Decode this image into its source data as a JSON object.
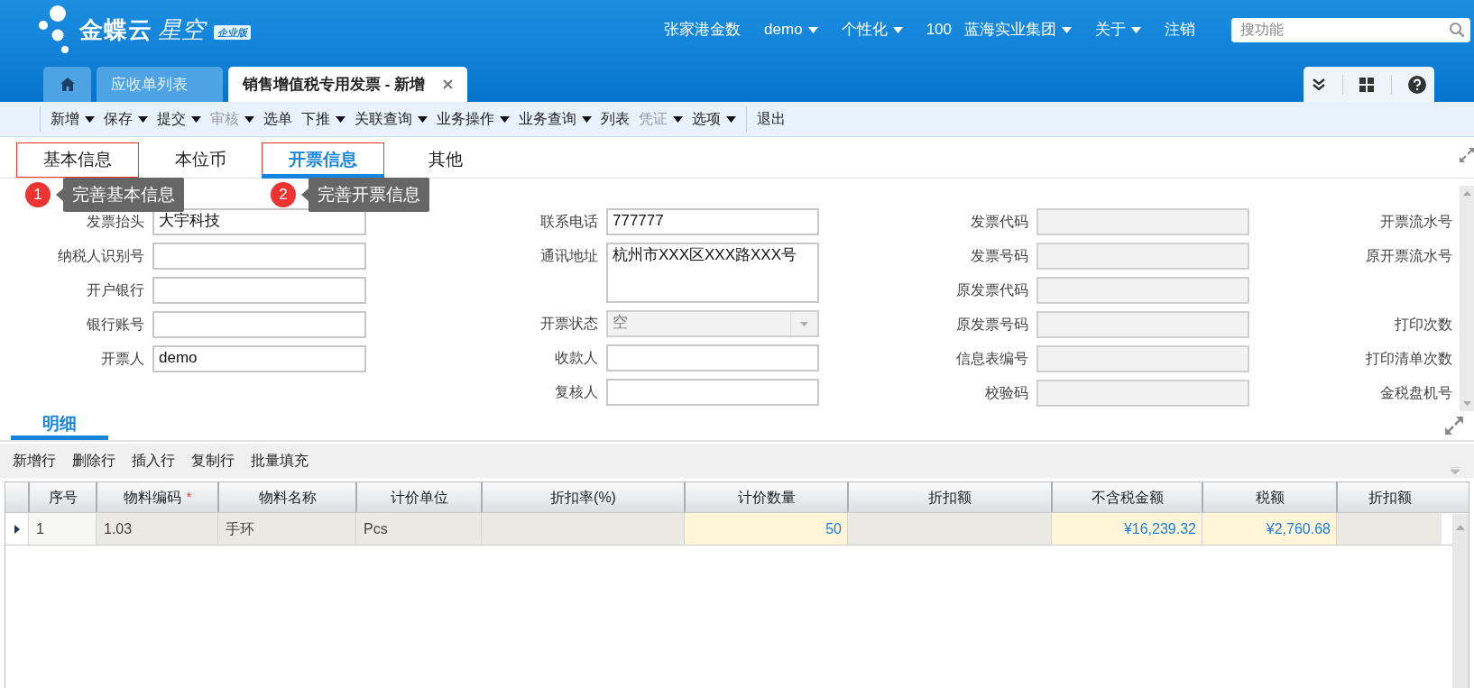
{
  "header": {
    "logo": {
      "brand": "金蝶云",
      "product": "星空",
      "edition": "企业版"
    },
    "nav": [
      {
        "label": "张家港金数",
        "dropdown": false
      },
      {
        "label": "demo",
        "dropdown": true
      },
      {
        "label": "个性化",
        "dropdown": true
      },
      {
        "code": "100",
        "label": "蓝海实业集团",
        "dropdown": true
      },
      {
        "label": "关于",
        "dropdown": true
      },
      {
        "label": "注销",
        "dropdown": false
      }
    ],
    "search": {
      "placeholder": "搜功能"
    }
  },
  "tabs": [
    {
      "kind": "home",
      "selected": false
    },
    {
      "kind": "page",
      "label": "应收单列表",
      "selected": false,
      "closable": false
    },
    {
      "kind": "page",
      "label": "销售增值税专用发票 - 新增",
      "selected": true,
      "closable": true
    }
  ],
  "toolbar": [
    {
      "kind": "divider"
    },
    {
      "kind": "button",
      "label": "新增",
      "dropdown": true,
      "disabled": false
    },
    {
      "kind": "button",
      "label": "保存",
      "dropdown": true,
      "disabled": false
    },
    {
      "kind": "button",
      "label": "提交",
      "dropdown": true,
      "disabled": false
    },
    {
      "kind": "button",
      "label": "审核",
      "dropdown": true,
      "disabled": true
    },
    {
      "kind": "button",
      "label": "选单",
      "dropdown": false,
      "disabled": false
    },
    {
      "kind": "button",
      "label": "下推",
      "dropdown": true,
      "disabled": false
    },
    {
      "kind": "button",
      "label": "关联查询",
      "dropdown": true,
      "disabled": false
    },
    {
      "kind": "button",
      "label": "业务操作",
      "dropdown": true,
      "disabled": false
    },
    {
      "kind": "button",
      "label": "业务查询",
      "dropdown": true,
      "disabled": false
    },
    {
      "kind": "button",
      "label": "列表",
      "dropdown": false,
      "disabled": false
    },
    {
      "kind": "button",
      "label": "凭证",
      "dropdown": true,
      "disabled": true
    },
    {
      "kind": "button",
      "label": "选项",
      "dropdown": true,
      "disabled": false
    },
    {
      "kind": "divider"
    },
    {
      "kind": "button",
      "label": "退出",
      "dropdown": false,
      "disabled": false
    }
  ],
  "form_tabs": [
    {
      "label": "基本信息",
      "selected": false,
      "highlighted": true,
      "callout": {
        "number": "1",
        "text": "完善基本信息"
      }
    },
    {
      "label": "本位币",
      "selected": false,
      "highlighted": false
    },
    {
      "label": "开票信息",
      "selected": true,
      "highlighted": true,
      "callout": {
        "number": "2",
        "text": "完善开票信息"
      }
    },
    {
      "label": "其他",
      "selected": false,
      "highlighted": false
    }
  ],
  "form": {
    "columns": [
      [
        {
          "kind": "text",
          "label": "发票抬头",
          "value": "大宇科技",
          "disabled": false
        },
        {
          "kind": "text",
          "label": "纳税人识别号",
          "disabled": false
        },
        {
          "kind": "text",
          "label": "开户银行",
          "disabled": false
        },
        {
          "kind": "text",
          "label": "银行账号",
          "disabled": false
        },
        {
          "kind": "text",
          "label": "开票人",
          "value": "demo",
          "disabled": false
        }
      ],
      [
        {
          "kind": "text",
          "label": "联系电话",
          "value": "777777",
          "disabled": false
        },
        {
          "kind": "textarea",
          "label": "通讯地址",
          "value": "杭州市XXX区XXX路XXX号",
          "disabled": false
        },
        {
          "kind": "combo",
          "label": "开票状态",
          "value": "空",
          "disabled": true
        },
        {
          "kind": "text",
          "label": "收款人",
          "disabled": false
        },
        {
          "kind": "text",
          "label": "复核人",
          "disabled": false
        }
      ],
      [
        {
          "kind": "text",
          "label": "发票代码",
          "disabled": true
        },
        {
          "kind": "text",
          "label": "发票号码",
          "disabled": true
        },
        {
          "kind": "text",
          "label": "原发票代码",
          "disabled": true
        },
        {
          "kind": "text",
          "label": "原发票号码",
          "disabled": true
        },
        {
          "kind": "text",
          "label": "信息表编号",
          "disabled": true
        },
        {
          "kind": "text",
          "label": "校验码",
          "disabled": true
        }
      ],
      [
        {
          "kind": "label",
          "label": "开票流水号"
        },
        {
          "kind": "label",
          "label": "原开票流水号"
        },
        {
          "kind": "spacer"
        },
        {
          "kind": "label",
          "label": "打印次数"
        },
        {
          "kind": "label",
          "label": "打印清单次数"
        },
        {
          "kind": "label",
          "label": "金税盘机号"
        }
      ]
    ]
  },
  "detail": {
    "tab": {
      "label": "明细",
      "selected": true
    },
    "actions": [
      "新增行",
      "删除行",
      "插入行",
      "复制行",
      "批量填充"
    ],
    "columns": [
      {
        "label": "序号",
        "kind": "index"
      },
      {
        "label": "物料编码",
        "kind": "text",
        "required_mark": "*"
      },
      {
        "label": "物料名称",
        "kind": "text"
      },
      {
        "label": "计价单位",
        "kind": "text"
      },
      {
        "label": "折扣率(%)",
        "kind": "number"
      },
      {
        "label": "计价数量",
        "kind": "number"
      },
      {
        "label": "折扣额",
        "kind": "number"
      },
      {
        "label": "不含税金额",
        "kind": "number"
      },
      {
        "label": "税额",
        "kind": "number"
      },
      {
        "label": "折扣额",
        "kind": "number"
      }
    ],
    "rows": [
      {
        "selected": true,
        "cells": [
          {
            "value": "1",
            "locked": false
          },
          {
            "value": "1.03",
            "locked": true
          },
          {
            "value": "手环",
            "locked": true
          },
          {
            "value": "Pcs",
            "locked": true
          },
          {
            "locked": true
          },
          {
            "value": "50",
            "locked": false
          },
          {
            "locked": true
          },
          {
            "value": "¥16,239.32",
            "locked": false
          },
          {
            "value": "¥2,760.68",
            "locked": false
          },
          {
            "locked": true
          }
        ]
      }
    ]
  }
}
